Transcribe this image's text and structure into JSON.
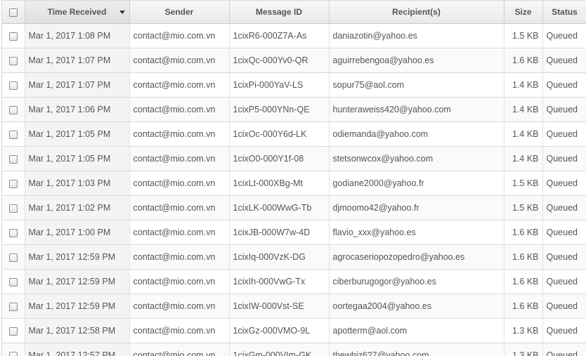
{
  "columns": {
    "time": "Time Received",
    "sender": "Sender",
    "message_id": "Message ID",
    "recipients": "Recipient(s)",
    "size": "Size",
    "status": "Status"
  },
  "sort": {
    "column": "time",
    "direction": "descending"
  },
  "rows": [
    {
      "time": "Mar 1, 2017 1:08 PM",
      "sender": "contact@mio.com.vn",
      "message_id": "1cixR6-000Z7A-As",
      "recipients": "daniazotin@yahoo.es",
      "size": "1.5 KB",
      "status": "Queued"
    },
    {
      "time": "Mar 1, 2017 1:07 PM",
      "sender": "contact@mio.com.vn",
      "message_id": "1cixQc-000Yv0-QR",
      "recipients": "aguirrebengoa@yahoo.es",
      "size": "1.6 KB",
      "status": "Queued"
    },
    {
      "time": "Mar 1, 2017 1:07 PM",
      "sender": "contact@mio.com.vn",
      "message_id": "1cixPi-000YaV-LS",
      "recipients": "sopur75@aol.com",
      "size": "1.4 KB",
      "status": "Queued"
    },
    {
      "time": "Mar 1, 2017 1:06 PM",
      "sender": "contact@mio.com.vn",
      "message_id": "1cixP5-000YNn-QE",
      "recipients": "hunteraweiss420@yahoo.com",
      "size": "1.4 KB",
      "status": "Queued"
    },
    {
      "time": "Mar 1, 2017 1:05 PM",
      "sender": "contact@mio.com.vn",
      "message_id": "1cixOc-000Y6d-LK",
      "recipients": "odiemanda@yahoo.com",
      "size": "1.4 KB",
      "status": "Queued"
    },
    {
      "time": "Mar 1, 2017 1:05 PM",
      "sender": "contact@mio.com.vn",
      "message_id": "1cixO0-000Y1f-08",
      "recipients": "stetsonwcox@yahoo.com",
      "size": "1.4 KB",
      "status": "Queued"
    },
    {
      "time": "Mar 1, 2017 1:03 PM",
      "sender": "contact@mio.com.vn",
      "message_id": "1cixLt-000XBg-Mt",
      "recipients": "godiane2000@yahoo.fr",
      "size": "1.5 KB",
      "status": "Queued"
    },
    {
      "time": "Mar 1, 2017 1:02 PM",
      "sender": "contact@mio.com.vn",
      "message_id": "1cixLK-000WwG-Tb",
      "recipients": "djmoomo42@yahoo.fr",
      "size": "1.5 KB",
      "status": "Queued"
    },
    {
      "time": "Mar 1, 2017 1:00 PM",
      "sender": "contact@mio.com.vn",
      "message_id": "1cixJB-000W7w-4D",
      "recipients": "flavio_xxx@yahoo.es",
      "size": "1.6 KB",
      "status": "Queued"
    },
    {
      "time": "Mar 1, 2017 12:59 PM",
      "sender": "contact@mio.com.vn",
      "message_id": "1cixIq-000VzK-DG",
      "recipients": "agrocaseriopozopedro@yahoo.es",
      "size": "1.6 KB",
      "status": "Queued"
    },
    {
      "time": "Mar 1, 2017 12:59 PM",
      "sender": "contact@mio.com.vn",
      "message_id": "1cixIh-000VwG-Tx",
      "recipients": "ciberburugogor@yahoo.es",
      "size": "1.6 KB",
      "status": "Queued"
    },
    {
      "time": "Mar 1, 2017 12:59 PM",
      "sender": "contact@mio.com.vn",
      "message_id": "1cixIW-000Vst-SE",
      "recipients": "oortegaa2004@yahoo.es",
      "size": "1.6 KB",
      "status": "Queued"
    },
    {
      "time": "Mar 1, 2017 12:58 PM",
      "sender": "contact@mio.com.vn",
      "message_id": "1cixGz-000VMO-9L",
      "recipients": "apotterm@aol.com",
      "size": "1.3 KB",
      "status": "Queued"
    },
    {
      "time": "Mar 1, 2017 12:57 PM",
      "sender": "contact@mio.com.vn",
      "message_id": "1cixGm-000VIm-GK",
      "recipients": "thewhiz627@yahoo.com",
      "size": "1.3 KB",
      "status": "Queued"
    }
  ]
}
